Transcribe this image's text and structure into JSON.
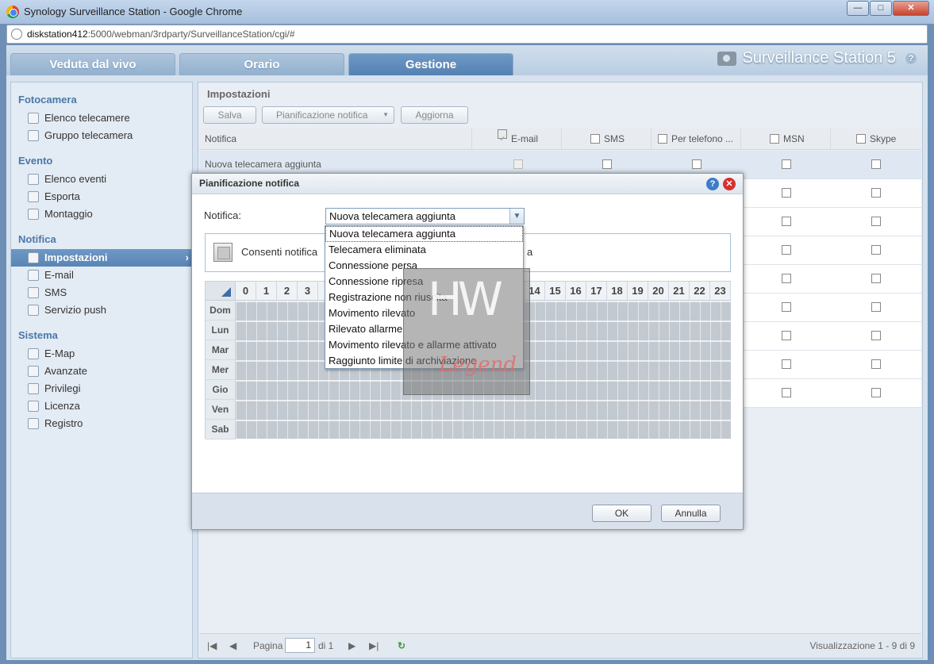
{
  "window": {
    "title": "Synology Surveillance Station - Google Chrome",
    "url_host": "diskstation412",
    "url_rest": ":5000/webman/3rdparty/SurveillanceStation/cgi/#"
  },
  "tabs": [
    {
      "label": "Veduta dal vivo"
    },
    {
      "label": "Orario"
    },
    {
      "label": "Gestione"
    }
  ],
  "brand": {
    "title": "Surveillance Station 5",
    "help": "?"
  },
  "sidebar": {
    "groups": [
      {
        "label": "Fotocamera"
      },
      {
        "label": "Evento"
      },
      {
        "label": "Notifica"
      },
      {
        "label": "Sistema"
      }
    ],
    "items": [
      {
        "label": "Elenco telecamere"
      },
      {
        "label": "Gruppo telecamera"
      },
      {
        "label": "Elenco eventi"
      },
      {
        "label": "Esporta"
      },
      {
        "label": "Montaggio"
      },
      {
        "label": "Impostazioni"
      },
      {
        "label": "E-mail"
      },
      {
        "label": "SMS"
      },
      {
        "label": "Servizio push"
      },
      {
        "label": "E-Map"
      },
      {
        "label": "Avanzate"
      },
      {
        "label": "Privilegi"
      },
      {
        "label": "Licenza"
      },
      {
        "label": "Registro"
      }
    ]
  },
  "panel": {
    "title": "Impostazioni",
    "toolbar": {
      "save": "Salva",
      "schedule": "Pianificazione notifica",
      "refresh": "Aggiorna"
    },
    "columns": [
      "Notifica",
      "E-mail",
      "SMS",
      "Per telefono ...",
      "MSN",
      "Skype"
    ],
    "first_row": "Nuova telecamera aggiunta"
  },
  "pager": {
    "page_label": "Pagina",
    "page": "1",
    "of": "di 1",
    "summary": "Visualizzazione 1 - 9 di 9"
  },
  "dialog": {
    "title": "Pianificazione notifica",
    "field_label": "Notifica:",
    "selected": "Nuova telecamera aggiunta",
    "consent_left": "Consenti notifica",
    "consent_right": "a",
    "hours": [
      "0",
      "1",
      "2",
      "3",
      "14",
      "15",
      "16",
      "17",
      "18",
      "19",
      "20",
      "21",
      "22",
      "23"
    ],
    "days": [
      "Dom",
      "Lun",
      "Mar",
      "Mer",
      "Gio",
      "Ven",
      "Sab"
    ],
    "ok": "OK",
    "cancel": "Annulla",
    "options": [
      "Nuova telecamera aggiunta",
      "Telecamera eliminata",
      "Connessione persa",
      "Connessione ripresa",
      "Registrazione non riuscita",
      "Movimento rilevato",
      "Rilevato allarme",
      "Movimento rilevato e allarme attivato",
      "Raggiunto limite di archiviazione"
    ]
  },
  "watermark": {
    "top": "HW",
    "bottom": "Legend"
  }
}
